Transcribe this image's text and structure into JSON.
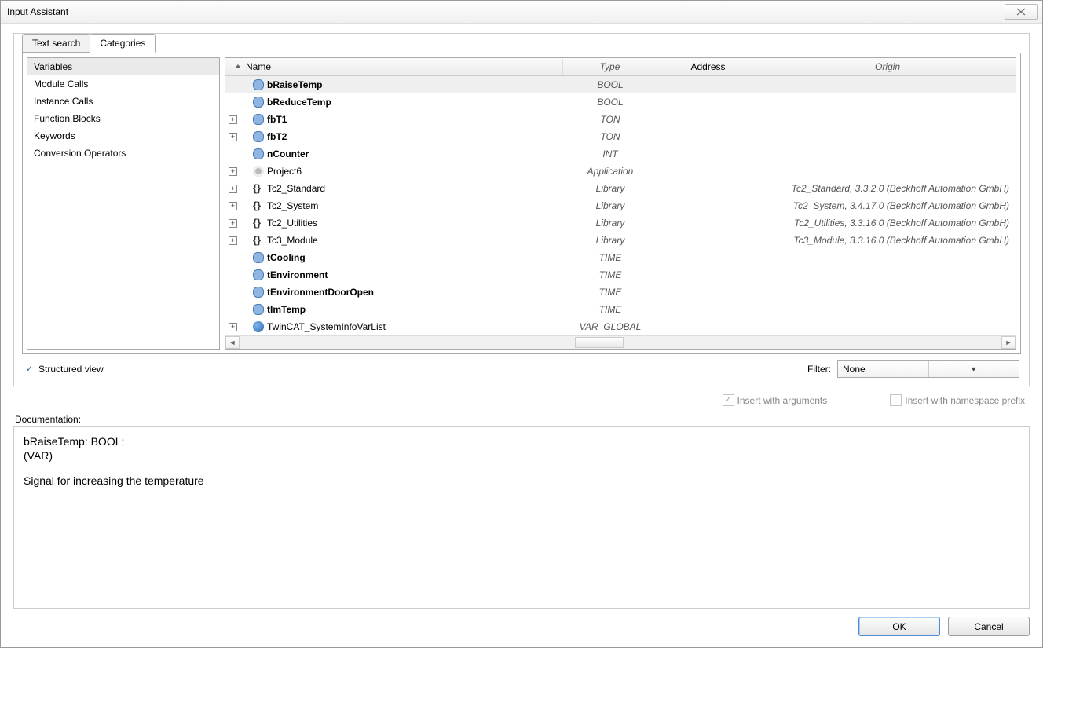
{
  "titlebar": {
    "title": "Input Assistant"
  },
  "tabs": {
    "text_search": "Text search",
    "categories": "Categories"
  },
  "sidebar": {
    "items": [
      {
        "label": "Variables",
        "selected": true
      },
      {
        "label": "Module Calls"
      },
      {
        "label": "Instance Calls"
      },
      {
        "label": "Function Blocks"
      },
      {
        "label": "Keywords"
      },
      {
        "label": "Conversion Operators"
      }
    ]
  },
  "columns": {
    "name": "Name",
    "type": "Type",
    "address": "Address",
    "origin": "Origin"
  },
  "rows": [
    {
      "exp": null,
      "icon": "var",
      "name": "bRaiseTemp",
      "bold": true,
      "type": "BOOL",
      "origin": "",
      "selected": true
    },
    {
      "exp": null,
      "icon": "var",
      "name": "bReduceTemp",
      "bold": true,
      "type": "BOOL",
      "origin": ""
    },
    {
      "exp": "+",
      "icon": "var",
      "name": "fbT1",
      "bold": true,
      "type": "TON",
      "origin": ""
    },
    {
      "exp": "+",
      "icon": "var",
      "name": "fbT2",
      "bold": true,
      "type": "TON",
      "origin": ""
    },
    {
      "exp": null,
      "icon": "var",
      "name": "nCounter",
      "bold": true,
      "type": "INT",
      "origin": ""
    },
    {
      "exp": "+",
      "icon": "gear",
      "name": "Project6",
      "bold": false,
      "type": "Application",
      "origin": ""
    },
    {
      "exp": "+",
      "icon": "brack",
      "name": "Tc2_Standard",
      "bold": false,
      "type": "Library",
      "origin": "Tc2_Standard, 3.3.2.0 (Beckhoff Automation GmbH)"
    },
    {
      "exp": "+",
      "icon": "brack",
      "name": "Tc2_System",
      "bold": false,
      "type": "Library",
      "origin": "Tc2_System, 3.4.17.0 (Beckhoff Automation GmbH)"
    },
    {
      "exp": "+",
      "icon": "brack",
      "name": "Tc2_Utilities",
      "bold": false,
      "type": "Library",
      "origin": "Tc2_Utilities, 3.3.16.0 (Beckhoff Automation GmbH)"
    },
    {
      "exp": "+",
      "icon": "brack",
      "name": "Tc3_Module",
      "bold": false,
      "type": "Library",
      "origin": "Tc3_Module, 3.3.16.0 (Beckhoff Automation GmbH)"
    },
    {
      "exp": null,
      "icon": "var",
      "name": "tCooling",
      "bold": true,
      "type": "TIME",
      "origin": ""
    },
    {
      "exp": null,
      "icon": "var",
      "name": "tEnvironment",
      "bold": true,
      "type": "TIME",
      "origin": ""
    },
    {
      "exp": null,
      "icon": "var",
      "name": "tEnvironmentDoorOpen",
      "bold": true,
      "type": "TIME",
      "origin": ""
    },
    {
      "exp": null,
      "icon": "var",
      "name": "tImTemp",
      "bold": true,
      "type": "TIME",
      "origin": ""
    },
    {
      "exp": "+",
      "icon": "globe",
      "name": "TwinCAT_SystemInfoVarList",
      "bold": false,
      "type": "VAR_GLOBAL",
      "origin": ""
    }
  ],
  "below": {
    "structured_view": "Structured view",
    "filter_label": "Filter:",
    "filter_value": "None"
  },
  "options": {
    "insert_args": "Insert with arguments",
    "insert_ns": "Insert with namespace prefix"
  },
  "documentation": {
    "label": "Documentation:",
    "line1": "bRaiseTemp: BOOL;",
    "line2": "(VAR)",
    "line3": "Signal for increasing the temperature"
  },
  "buttons": {
    "ok": "OK",
    "cancel": "Cancel"
  }
}
